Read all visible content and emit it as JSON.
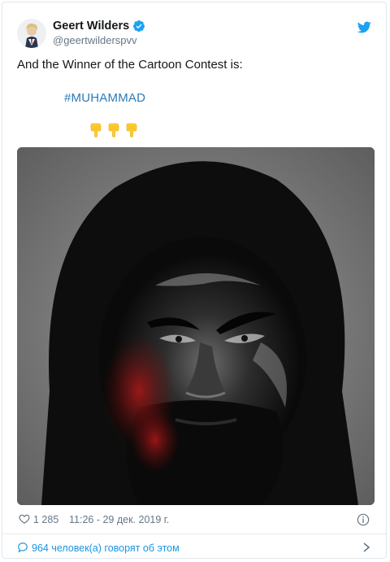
{
  "author": {
    "display_name": "Geert Wilders",
    "handle": "@geertwilderspvv",
    "verified": true
  },
  "tweet": {
    "text": "And the Winner of the Cartoon Contest is:",
    "hashtag": "#MUHAMMAD",
    "emoji": [
      "backhand-index-pointing-down",
      "backhand-index-pointing-down",
      "backhand-index-pointing-down"
    ],
    "media": {
      "type": "image",
      "icon": "dark-portrait-painting"
    }
  },
  "footer": {
    "like_count": "1 285",
    "timestamp": "11:26 - 29 дек. 2019 г."
  },
  "conversation": {
    "label": "964 человек(а) говорят об этом"
  },
  "colors": {
    "link": "#2b7bb9",
    "twitter_blue": "#1da1f2",
    "muted": "#657786"
  }
}
